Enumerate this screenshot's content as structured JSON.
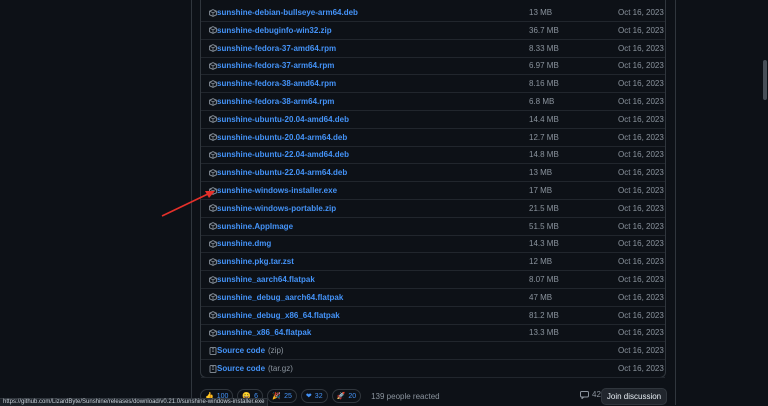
{
  "assets": [
    {
      "name": "sunshine-debian-bullseye-arm64.deb",
      "size": "13 MB",
      "date": "Oct 16, 2023"
    },
    {
      "name": "sunshine-debuginfo-win32.zip",
      "size": "36.7 MB",
      "date": "Oct 16, 2023"
    },
    {
      "name": "sunshine-fedora-37-amd64.rpm",
      "size": "8.33 MB",
      "date": "Oct 16, 2023"
    },
    {
      "name": "sunshine-fedora-37-arm64.rpm",
      "size": "6.97 MB",
      "date": "Oct 16, 2023"
    },
    {
      "name": "sunshine-fedora-38-amd64.rpm",
      "size": "8.16 MB",
      "date": "Oct 16, 2023"
    },
    {
      "name": "sunshine-fedora-38-arm64.rpm",
      "size": "6.8 MB",
      "date": "Oct 16, 2023"
    },
    {
      "name": "sunshine-ubuntu-20.04-amd64.deb",
      "size": "14.4 MB",
      "date": "Oct 16, 2023"
    },
    {
      "name": "sunshine-ubuntu-20.04-arm64.deb",
      "size": "12.7 MB",
      "date": "Oct 16, 2023"
    },
    {
      "name": "sunshine-ubuntu-22.04-amd64.deb",
      "size": "14.8 MB",
      "date": "Oct 16, 2023"
    },
    {
      "name": "sunshine-ubuntu-22.04-arm64.deb",
      "size": "13 MB",
      "date": "Oct 16, 2023"
    },
    {
      "name": "sunshine-windows-installer.exe",
      "size": "17 MB",
      "date": "Oct 16, 2023"
    },
    {
      "name": "sunshine-windows-portable.zip",
      "size": "21.5 MB",
      "date": "Oct 16, 2023"
    },
    {
      "name": "sunshine.AppImage",
      "size": "51.5 MB",
      "date": "Oct 16, 2023"
    },
    {
      "name": "sunshine.dmg",
      "size": "14.3 MB",
      "date": "Oct 16, 2023"
    },
    {
      "name": "sunshine.pkg.tar.zst",
      "size": "12 MB",
      "date": "Oct 16, 2023"
    },
    {
      "name": "sunshine_aarch64.flatpak",
      "size": "8.07 MB",
      "date": "Oct 16, 2023"
    },
    {
      "name": "sunshine_debug_aarch64.flatpak",
      "size": "47 MB",
      "date": "Oct 16, 2023"
    },
    {
      "name": "sunshine_debug_x86_64.flatpak",
      "size": "81.2 MB",
      "date": "Oct 16, 2023"
    },
    {
      "name": "sunshine_x86_64.flatpak",
      "size": "13.3 MB",
      "date": "Oct 16, 2023"
    }
  ],
  "sources": [
    {
      "name": "Source code",
      "ext": "(zip)",
      "date": "Oct 16, 2023"
    },
    {
      "name": "Source code",
      "ext": "(tar.gz)",
      "date": "Oct 16, 2023"
    }
  ],
  "reactions": [
    {
      "icon": "thumbs-up-icon",
      "glyph": "👍",
      "count": "100"
    },
    {
      "icon": "laugh-icon",
      "glyph": "😄",
      "count": "6"
    },
    {
      "icon": "tada-icon",
      "glyph": "🎉",
      "count": "25"
    },
    {
      "icon": "heart-icon",
      "glyph": "❤",
      "count": "32"
    },
    {
      "icon": "rocket-icon",
      "glyph": "🚀",
      "count": "20"
    }
  ],
  "reacted_text": "139 people reacted",
  "comments_count": "42",
  "join_label": "Join discussion",
  "status_url": "https://github.com/LizardByte/Sunshine/releases/download/v0.21.0/sunshine-windows-installer.exe",
  "colors": {
    "link": "#4493f8",
    "muted": "#8b949e",
    "arrow": "#e5302a",
    "bg": "#0d1117"
  }
}
